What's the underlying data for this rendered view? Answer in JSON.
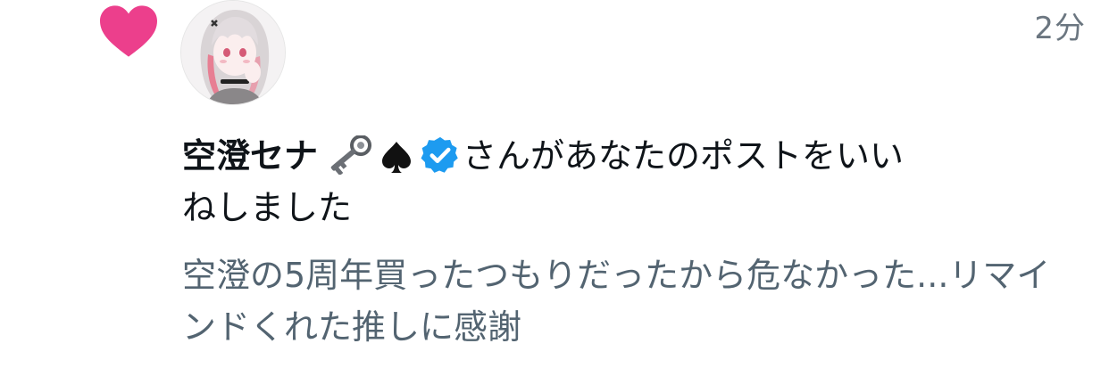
{
  "notification": {
    "type_icon": "heart-icon",
    "timestamp": "2分",
    "user": {
      "name": "空澄セナ",
      "emoji_icons": [
        "key-icon",
        "spade-icon"
      ],
      "verified_badge": "verified-badge-icon"
    },
    "action_text_line1": "さんがあなたのポストをいい",
    "action_text_line2": "ねしました",
    "post_preview": "空澄の5周年買ったつもりだったから危なかった...リマインドくれた推しに感謝"
  },
  "colors": {
    "heart": "#f91880",
    "verified": "#1d9bf0",
    "text_primary": "#0f1419",
    "text_secondary": "#536471"
  }
}
